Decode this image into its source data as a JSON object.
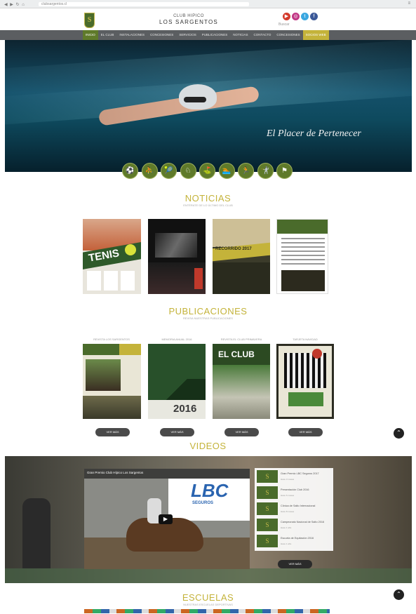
{
  "browser": {
    "url": "clubsargentos.cl",
    "nav_glyphs": "◀ ▶ ↻ ⌂",
    "menu_glyph": "≡"
  },
  "header": {
    "club_small": "CLUB HIPICO",
    "club_big": "LOS SARGENTOS",
    "logo_letter": "S",
    "search_label": "Buscar"
  },
  "social": [
    {
      "name": "youtube-icon",
      "glyph": "▶",
      "color": "#d33a2c"
    },
    {
      "name": "instagram-icon",
      "glyph": "◎",
      "color": "#c13584"
    },
    {
      "name": "twitter-icon",
      "glyph": "t",
      "color": "#3aa7e0"
    },
    {
      "name": "facebook-icon",
      "glyph": "f",
      "color": "#3b5998"
    }
  ],
  "nav": [
    "INICIO",
    "EL CLUB",
    "INSTALACIONES",
    "CONCESIONES",
    "SERVICIOS",
    "PUBLICACIONES",
    "NOTICIAS",
    "CONTACTO",
    "CONCESIONES",
    "SOCIOS WEB"
  ],
  "hero": {
    "tagline": "El Placer de Pertenecer"
  },
  "sports": [
    "⚽",
    "⛹",
    "🎾",
    "♘",
    "⛳",
    "🏊",
    "🏃",
    "🤺",
    "⚑"
  ],
  "noticias": {
    "title": "NOTICIAS",
    "subtitle": "ENTÉRATE DE LO ÚLTIMO DEL CLUB",
    "card1_text": "TENIS",
    "card3_text": "RECORRIDO 2017"
  },
  "publicaciones": {
    "title": "PUBLICACIONES",
    "subtitle": "REVISA NUESTRAS PUBLICACIONES",
    "items": [
      {
        "title": "REVISTA LOS SARGENTOS",
        "btn": "VER MÁS"
      },
      {
        "title": "MEMORIA ANUAL 2016",
        "btn": "VER MÁS"
      },
      {
        "title": "REVISTA EL CLUB PRIMAVERA",
        "btn": "VER MÁS"
      },
      {
        "title": "TARJETA NAVIDAD",
        "btn": "VER MÁS"
      }
    ],
    "year": "2016",
    "club_text": "EL CLUB"
  },
  "videos": {
    "title": "VIDEOS",
    "main_title": "Gran Premio Club Hípico Los Sargentos",
    "sponsor": "LBC",
    "sponsor_sub": "SEGUROS",
    "more_btn": "VER MÁS",
    "list": [
      {
        "title": "Gran Premio LBC Seguros 2017",
        "date": "Hace 3 meses"
      },
      {
        "title": "Presentación Club 2016",
        "date": "Hace 6 meses"
      },
      {
        "title": "Clínica de Salto Internacional",
        "date": "Hace 8 meses"
      },
      {
        "title": "Campeonato Nacional de Salto 2016",
        "date": "Hace 1 año"
      },
      {
        "title": "Escuela de Equitación 2016",
        "date": "Hace 1 año"
      }
    ]
  },
  "escuelas": {
    "title": "ESCUELAS",
    "subtitle": "NUESTRAS ESCUELAS DEPORTIVAS"
  }
}
